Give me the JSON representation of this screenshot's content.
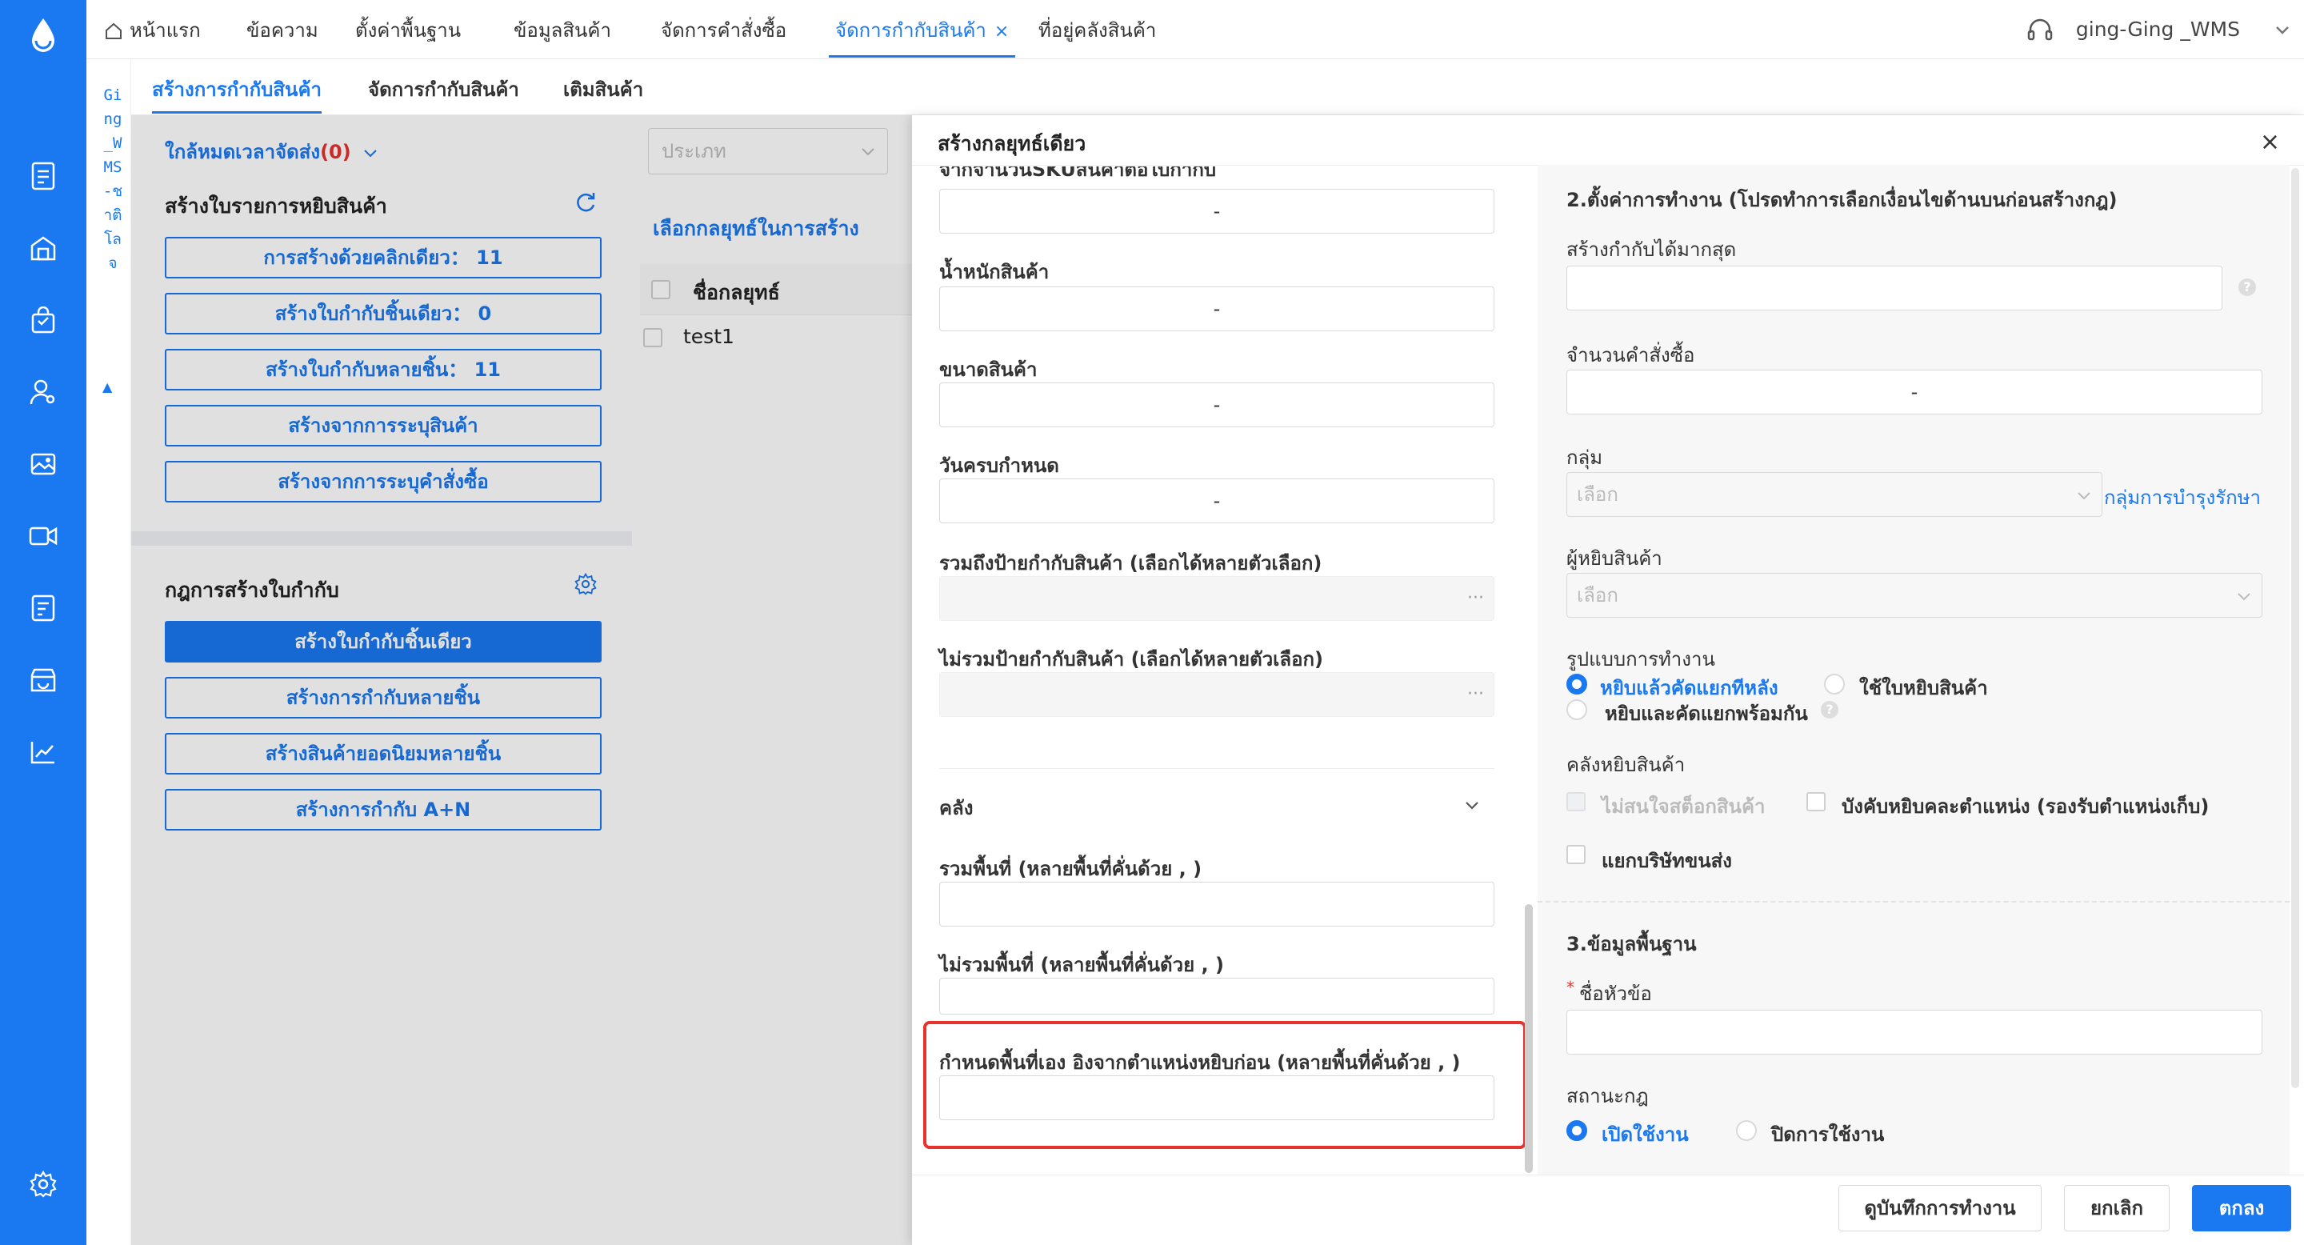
{
  "nav": {
    "home": "หน้าแรก",
    "items": [
      "ข้อความ",
      "ตั้งค่าพื้นฐาน",
      "ข้อมูลสินค้า",
      "จัดการคำสั่งซื้อ"
    ],
    "active": "จัดการกำกับสินค้า",
    "active_close": "×",
    "last": "ที่อยู่คลังสินค้า",
    "user": "ging-Ging _WMS"
  },
  "brand_vertical": "Ging_WMS-ชาติโลจ",
  "brand_arrow": "▲",
  "subtabs": [
    "สร้างการกำกับสินค้า",
    "จัดการกำกับสินค้า",
    "เติมสินค้า"
  ],
  "left": {
    "deadline_link": "ใกล้หมดเวลาจัดส่ง",
    "deadline_count": "(0)",
    "section1_title": "สร้างใบรายการหยิบสินค้า",
    "buttons1": [
      "การสร้างด้วยคลิกเดียว： 11",
      "สร้างใบกำกับชิ้นเดียว： 0",
      "สร้างใบกำกับหลายชิ้น： 11",
      "สร้างจากการระบุสินค้า",
      "สร้างจากการระบุคำสั่งซื้อ"
    ],
    "section2_title": "กฎการสร้างใบกำกับ",
    "buttons2": [
      "สร้างใบกำกับชิ้นเดียว",
      "สร้างการกำกับหลายชิ้น",
      "สร้างสินค้ายอดนิยมหลายชิ้น",
      "สร้างการกำกับ A+N"
    ]
  },
  "middle": {
    "select_placeholder": "ประเภท",
    "strategy_link": "เลือกกลยุทธ์ในการสร้าง",
    "col_header": "ชื่อกลยุทธ์",
    "rows": [
      "test1"
    ]
  },
  "drawer": {
    "title": "สร้างกลยุทธ์เดียว",
    "close": "×",
    "clipped_label": "จากจำนวนSKUสินค้าต่อใบกำกับ",
    "fields": [
      {
        "label": "น้ำหนักสินค้า",
        "value": "-"
      },
      {
        "label": "ขนาดสินค้า",
        "value": "-"
      },
      {
        "label": "วันครบกำหนด",
        "value": "-"
      }
    ],
    "first_value": "-",
    "include_tags": "รวมถึงป้ายกำกับสินค้า (เลือกได้หลายตัวเลือก)",
    "exclude_tags": "ไม่รวมป้ายกำกับสินค้า (เลือกได้หลายตัวเลือก)",
    "dots": "···",
    "warehouse_section": "คลัง",
    "include_area": "รวมพื้นที่ (หลายพื้นที่คั่นด้วย , )",
    "exclude_area": "ไม่รวมพื้นที่ (หลายพื้นที่คั่นด้วย , )",
    "custom_area": "กำหนดพื้นที่เอง อิงจากตำแหน่งหยิบก่อน (หลายพื้นที่คั่นด้วย , )"
  },
  "settings": {
    "section2": "2.ตั้งค่าการทำงาน (โปรดทำการเลือกเงื่อนไขด้านบนก่อนสร้างกฎ)",
    "max_create": "สร้างกำกับได้มากสุด",
    "order_count": "จำนวนคำสั่งซื้อ",
    "order_count_value": "-",
    "group": "กลุ่ม",
    "select_placeholder": "เลือก",
    "group_link": "กลุ่มการบำรุงรักษา",
    "picker": "ผู้หยิบสินค้า",
    "work_mode": "รูปแบบการทำงาน",
    "mode_opt1": "หยิบแล้วคัดแยกทีหลัง",
    "mode_opt2": "ใช้ใบหยิบสินค้า",
    "mode_opt3": "หยิบและคัดแยกพร้อมกัน",
    "pick_warehouse": "คลังหยิบสินค้า",
    "chk1": "ไม่สนใจสต็อกสินค้า",
    "chk2": "บังคับหยิบคละตำแหน่ง (รองรับตำแหน่งเก็บ)",
    "chk3": "แยกบริษัทขนส่ง",
    "section3": "3.ข้อมูลพื้นฐาน",
    "required_mark": "*",
    "title_label": "ชื่อหัวข้อ",
    "rule_status": "สถานะกฎ",
    "status_on": "เปิดใช้งาน",
    "status_off": "ปิดการใช้งาน"
  },
  "footer": {
    "save_work": "ดูบันทึกการทำงาน",
    "cancel": "ยกเลิก",
    "ok": "ตกลง"
  },
  "colors": {
    "accent": "#1a78f0",
    "highlight": "#e8322e"
  }
}
